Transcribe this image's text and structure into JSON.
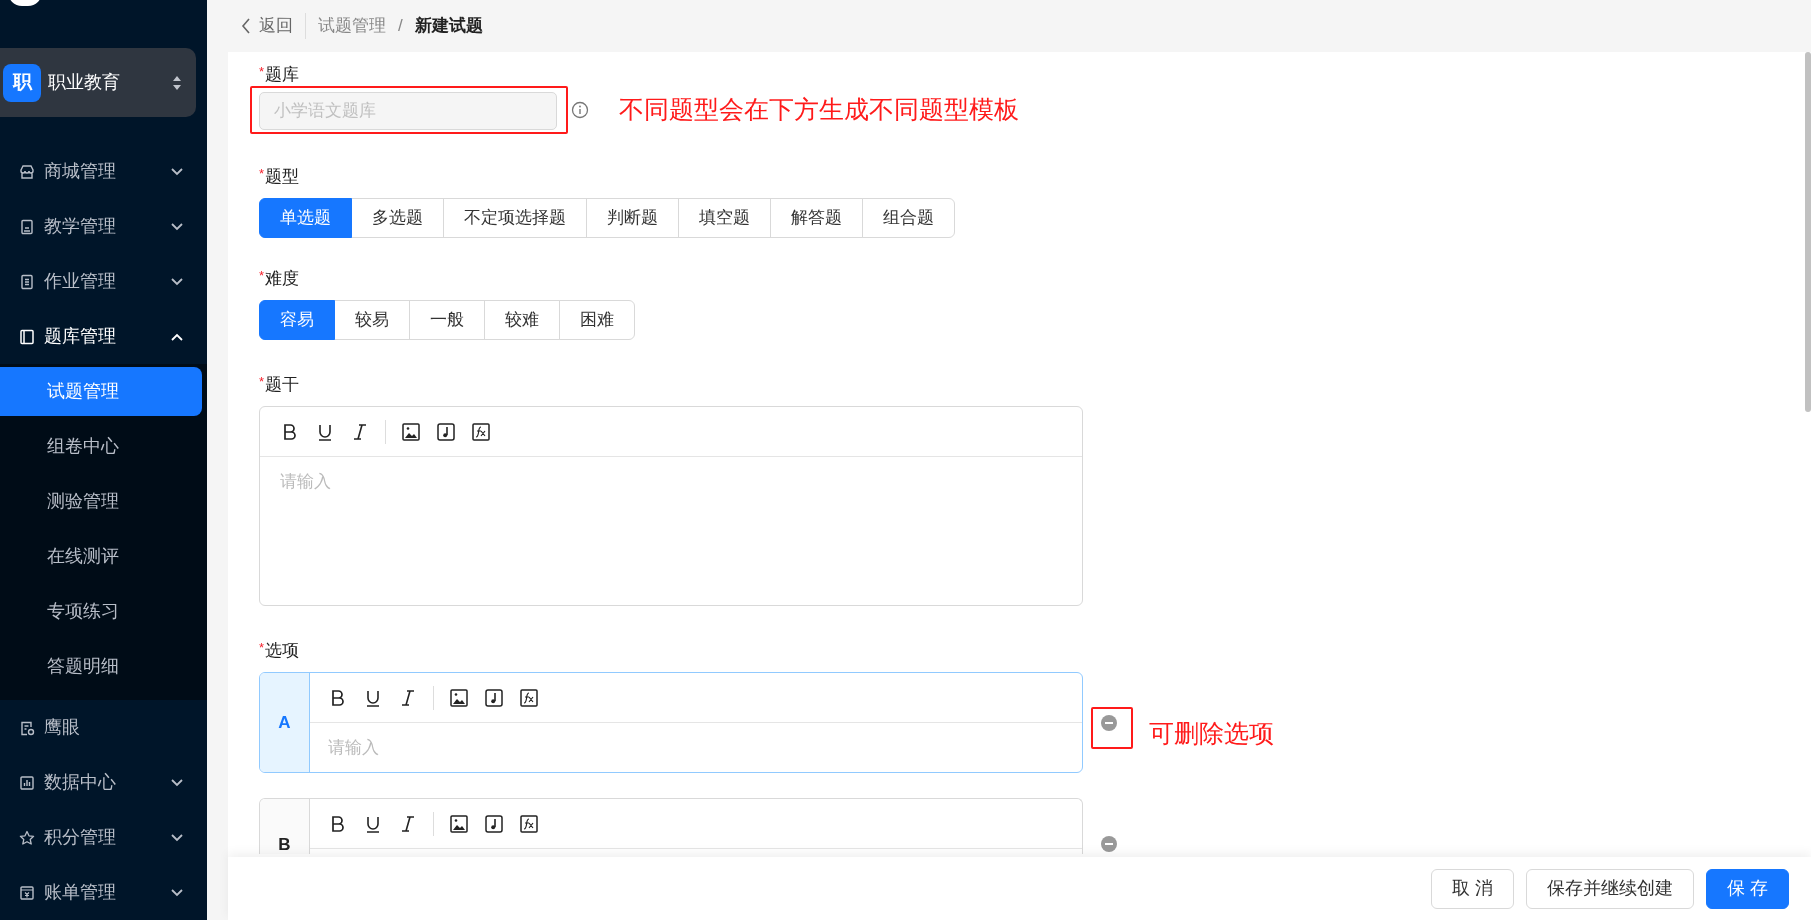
{
  "sidebar": {
    "org": {
      "badge": "职",
      "name": "职业教育"
    },
    "items": [
      {
        "label": "商城管理",
        "expandable": true,
        "expanded": false
      },
      {
        "label": "教学管理",
        "expandable": true,
        "expanded": false
      },
      {
        "label": "作业管理",
        "expandable": true,
        "expanded": false
      },
      {
        "label": "题库管理",
        "expandable": true,
        "expanded": true,
        "children": [
          {
            "label": "试题管理",
            "selected": true
          },
          {
            "label": "组卷中心",
            "selected": false
          },
          {
            "label": "测验管理",
            "selected": false
          },
          {
            "label": "在线测评",
            "selected": false
          },
          {
            "label": "专项练习",
            "selected": false
          },
          {
            "label": "答题明细",
            "selected": false
          }
        ]
      },
      {
        "label": "鹰眼",
        "expandable": false,
        "expanded": false
      },
      {
        "label": "数据中心",
        "expandable": true,
        "expanded": false
      },
      {
        "label": "积分管理",
        "expandable": true,
        "expanded": false
      },
      {
        "label": "账单管理",
        "expandable": true,
        "expanded": false
      }
    ]
  },
  "breadcrumb": {
    "back": "返回",
    "items": [
      "试题管理",
      "新建试题"
    ],
    "separator": "/"
  },
  "form": {
    "bank": {
      "label": "题库",
      "required_mark": "*",
      "placeholder": "小学语文题库",
      "disabled": true
    },
    "type": {
      "label": "题型",
      "required_mark": "*",
      "options": [
        {
          "label": "单选题",
          "selected": true
        },
        {
          "label": "多选题",
          "selected": false
        },
        {
          "label": "不定项选择题",
          "selected": false
        },
        {
          "label": "判断题",
          "selected": false
        },
        {
          "label": "填空题",
          "selected": false
        },
        {
          "label": "解答题",
          "selected": false
        },
        {
          "label": "组合题",
          "selected": false
        }
      ]
    },
    "difficulty": {
      "label": "难度",
      "required_mark": "*",
      "options": [
        {
          "label": "容易",
          "selected": true
        },
        {
          "label": "较易",
          "selected": false
        },
        {
          "label": "一般",
          "selected": false
        },
        {
          "label": "较难",
          "selected": false
        },
        {
          "label": "困难",
          "selected": false
        }
      ]
    },
    "stem": {
      "label": "题干",
      "required_mark": "*",
      "placeholder": "请输入"
    },
    "options_label": {
      "label": "选项",
      "required_mark": "*"
    },
    "options": [
      {
        "letter": "A",
        "placeholder": "请输入",
        "focused": true
      },
      {
        "letter": "B",
        "focused": false
      }
    ]
  },
  "annotations": [
    "不同题型会在下方生成不同题型模板",
    "可删除选项"
  ],
  "footer": {
    "buttons": [
      {
        "label": "取 消",
        "kind": "default"
      },
      {
        "label": "保存并继续创建",
        "kind": "default"
      },
      {
        "label": "保 存",
        "kind": "primary"
      }
    ]
  }
}
